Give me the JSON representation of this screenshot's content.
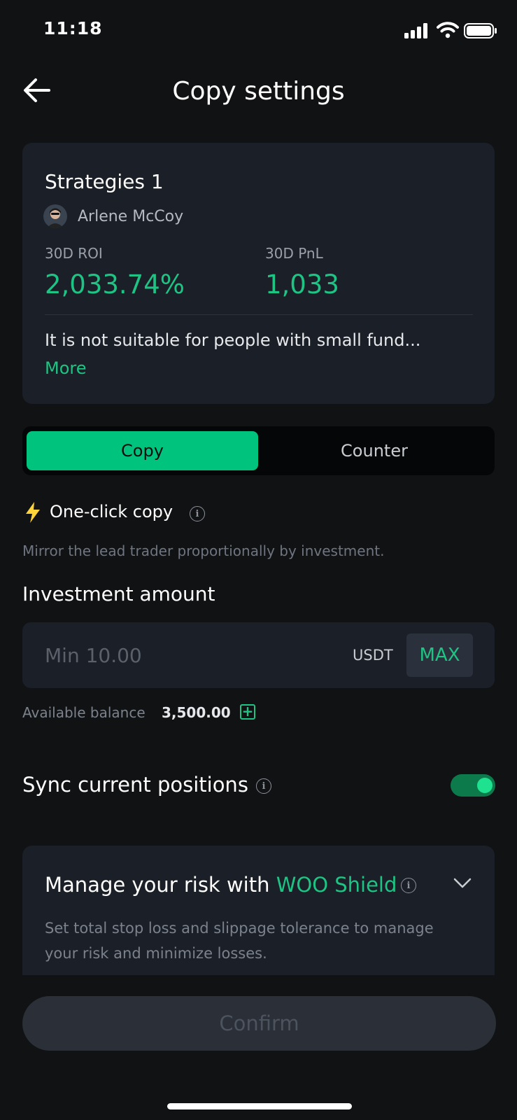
{
  "status_bar": {
    "time": "11:18"
  },
  "header": {
    "title": "Copy settings"
  },
  "strategy": {
    "name": "Strategies 1",
    "trader": "Arlene McCoy",
    "roi_label": "30D ROI",
    "roi_value": "2,033.74%",
    "pnl_label": "30D PnL",
    "pnl_value": "1,033",
    "description": "It is not suitable for people with small fund...",
    "more_label": "More"
  },
  "tabs": [
    {
      "label": "Copy",
      "active": true
    },
    {
      "label": "Counter",
      "active": false
    }
  ],
  "one_click": {
    "label": "One-click copy",
    "description": "Mirror the lead trader proportionally by investment."
  },
  "investment": {
    "label": "Investment amount",
    "placeholder": "Min 10.00",
    "value": "",
    "currency": "USDT",
    "max_label": "MAX",
    "available_label": "Available balance",
    "available_value": "3,500.00"
  },
  "sync": {
    "label": "Sync current positions",
    "enabled": true
  },
  "risk": {
    "title_prefix": "Manage your risk with ",
    "title_highlight": "WOO Shield",
    "description": "Set total stop loss and slippage tolerance to manage your risk and minimize losses."
  },
  "confirm_label": "Confirm",
  "colors": {
    "background": "#111214",
    "card": "#1b1f27",
    "accent": "#00c37e",
    "accent_text": "#1ec484",
    "toggle_on": "#0d7a4c"
  }
}
